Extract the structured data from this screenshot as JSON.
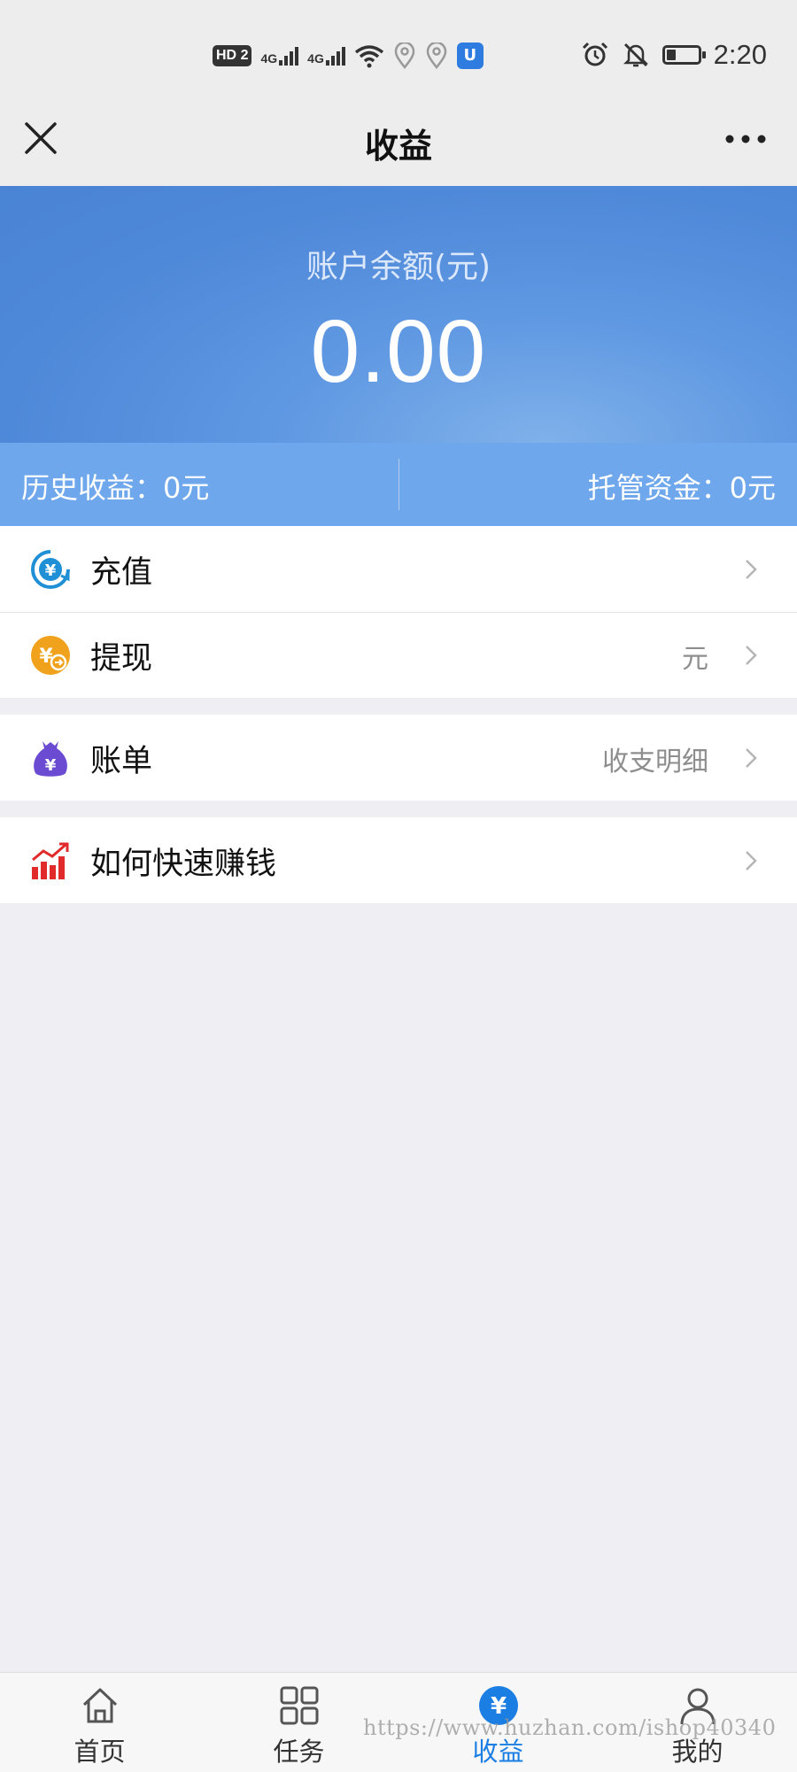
{
  "status_bar": {
    "hd_label": "HD",
    "sim2_label": "2",
    "net1": "4G",
    "net2": "4G",
    "time": "2:20",
    "battery_level": 0.3,
    "icons": [
      "hd-icon",
      "signal-icon",
      "signal-icon",
      "wifi-icon",
      "location-icon",
      "location-icon",
      "app-notification-icon",
      "alarm-icon",
      "mute-icon",
      "battery-icon"
    ]
  },
  "nav": {
    "title": "收益"
  },
  "balance": {
    "label": "账户余额(元)",
    "amount": "0.00"
  },
  "stats": {
    "history_earnings": "历史收益：0元",
    "escrow_funds": "托管资金：0元"
  },
  "menu": {
    "recharge": {
      "label": "充值",
      "icon": "yuan-refresh-icon",
      "color": "#1f8fd6"
    },
    "withdraw": {
      "label": "提现",
      "icon": "yuan-withdraw-icon",
      "sub": "元",
      "color": "#f0a21c"
    },
    "bill": {
      "label": "账单",
      "icon": "money-bag-icon",
      "sub": "收支明细",
      "color": "#6b4bd1"
    },
    "earn_tips": {
      "label": "如何快速赚钱",
      "icon": "bar-chart-icon",
      "color": "#e12b2b"
    }
  },
  "tabs": [
    {
      "label": "首页",
      "icon": "home-icon"
    },
    {
      "label": "任务",
      "icon": "grid-icon"
    },
    {
      "label": "收益",
      "icon": "yuan-icon",
      "active": true
    },
    {
      "label": "我的",
      "icon": "user-icon"
    }
  ],
  "colors": {
    "accent": "#1a7ee3",
    "header_blue": "#4e88d8",
    "stats_bar": "#6fa7ec"
  },
  "watermark": "https://www.huzhan.com/ishop40340"
}
